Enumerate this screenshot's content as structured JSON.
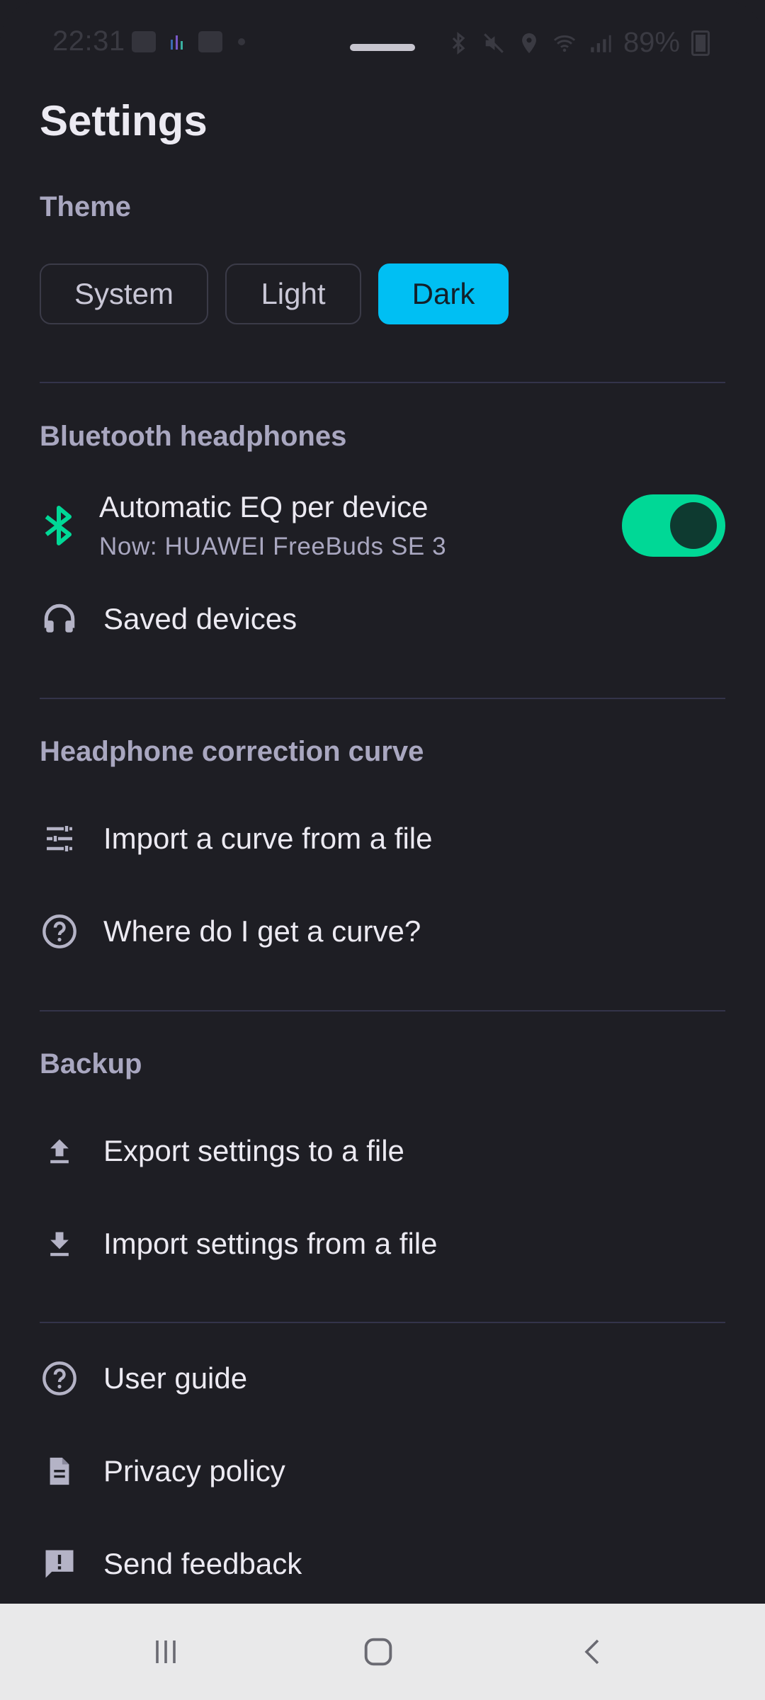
{
  "status_bar": {
    "time": "22:31",
    "battery": "89%"
  },
  "page": {
    "title": "Settings"
  },
  "theme": {
    "section_title": "Theme",
    "options": [
      "System",
      "Light",
      "Dark"
    ],
    "selected": "Dark"
  },
  "bluetooth": {
    "section_title": "Bluetooth headphones",
    "auto_eq_label": "Automatic EQ per device",
    "auto_eq_sub": "Now: HUAWEI FreeBuds SE 3",
    "auto_eq_enabled": true,
    "saved_devices_label": "Saved devices"
  },
  "correction": {
    "section_title": "Headphone correction curve",
    "import_label": "Import a curve from a file",
    "where_label": "Where do I get a curve?"
  },
  "backup": {
    "section_title": "Backup",
    "export_label": "Export settings to a file",
    "import_label": "Import settings from a file"
  },
  "misc": {
    "user_guide_label": "User guide",
    "privacy_label": "Privacy policy",
    "feedback_label": "Send feedback"
  },
  "colors": {
    "background": "#1e1e24",
    "accent_cyan": "#00bff3",
    "accent_green": "#00d896",
    "section_text": "#a9a7c0",
    "nav_bar": "#e9e9ea"
  },
  "icons": {
    "bluetooth": "bluetooth-icon",
    "headphones": "headphones-icon",
    "tune": "tune-icon",
    "help": "help-circle-icon",
    "upload": "upload-icon",
    "download": "download-icon",
    "document": "document-icon",
    "feedback": "feedback-icon"
  }
}
